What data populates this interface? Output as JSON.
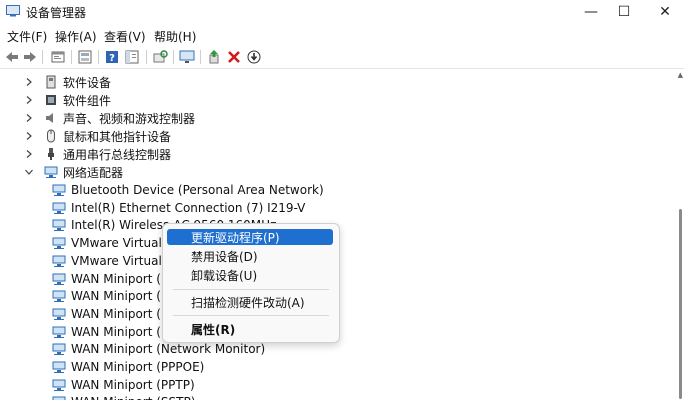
{
  "window": {
    "title": "设备管理器",
    "minimize": "—",
    "maximize": "☐",
    "close": "✕"
  },
  "menu": [
    "文件(F)",
    "操作(A)",
    "查看(V)",
    "帮助(H)"
  ],
  "toolbar_icons": [
    "back-arrow-icon",
    "forward-arrow-icon",
    "properties-window-icon",
    "panel-icon",
    "help-icon",
    "panel-view-icon",
    "scan-hardware-icon",
    "monitor-icon",
    "update-driver-icon",
    "uninstall-x-icon",
    "download-circle-icon"
  ],
  "tree": {
    "categories": [
      {
        "label": "软件设备",
        "expanded": false,
        "icon": "software-device-icon"
      },
      {
        "label": "软件组件",
        "expanded": false,
        "icon": "software-component-icon"
      },
      {
        "label": "声音、视频和游戏控制器",
        "expanded": false,
        "icon": "speaker-icon"
      },
      {
        "label": "鼠标和其他指针设备",
        "expanded": false,
        "icon": "mouse-icon"
      },
      {
        "label": "通用串行总线控制器",
        "expanded": false,
        "icon": "usb-icon"
      },
      {
        "label": "网络适配器",
        "expanded": true,
        "icon": "network-adapter-icon"
      }
    ],
    "adapters": [
      "Bluetooth Device (Personal Area Network)",
      "Intel(R) Ethernet Connection (7) I219-V",
      "Intel(R) Wireless-AC 9560 160MHz",
      "VMware Virtual E",
      "VMware Virtual E",
      "WAN Miniport (I",
      "WAN Miniport (I",
      "WAN Miniport (I",
      "WAN Miniport (L",
      "WAN Miniport (Network Monitor)",
      "WAN Miniport (PPPOE)",
      "WAN Miniport (PPTP)",
      "WAN Miniport (SSTP)"
    ]
  },
  "context_menu": {
    "items": [
      "更新驱动程序(P)",
      "禁用设备(D)",
      "卸载设备(U)",
      "扫描检测硬件改动(A)",
      "属性(R)"
    ],
    "selected_index": 0
  }
}
